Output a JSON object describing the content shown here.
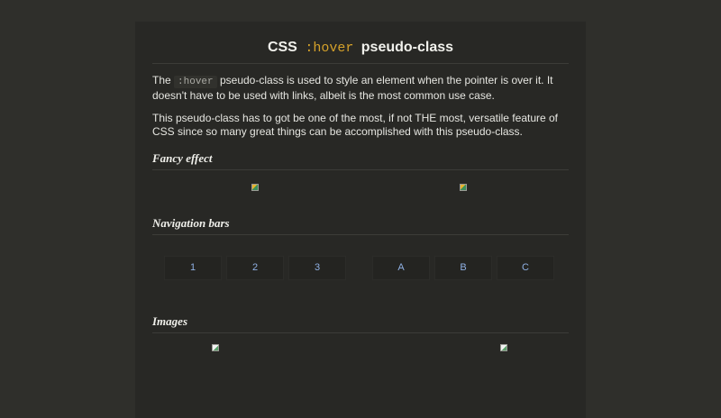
{
  "title": {
    "prefix": "CSS",
    "code": ":hover",
    "suffix": "pseudo-class"
  },
  "intro": {
    "p1_before": "The",
    "p1_code": ":hover",
    "p1_after": "pseudo-class is used to style an element when the pointer is over it. It doesn't have to be used with links, albeit is the most common use case.",
    "p2": "This pseudo-class has to got be one of the most, if not THE most, versatile feature of CSS since so many great things can be accomplished with this pseudo-class."
  },
  "sections": {
    "fancy": "Fancy effect",
    "nav": "Navigation bars",
    "images": "Images"
  },
  "nav_bars": {
    "left": [
      "1",
      "2",
      "3"
    ],
    "right": [
      "A",
      "B",
      "C"
    ]
  },
  "colors": {
    "background": "#2f2f2b",
    "card": "#282825",
    "accent_code": "#d4a12a",
    "nav_link": "#8fb0e3"
  }
}
